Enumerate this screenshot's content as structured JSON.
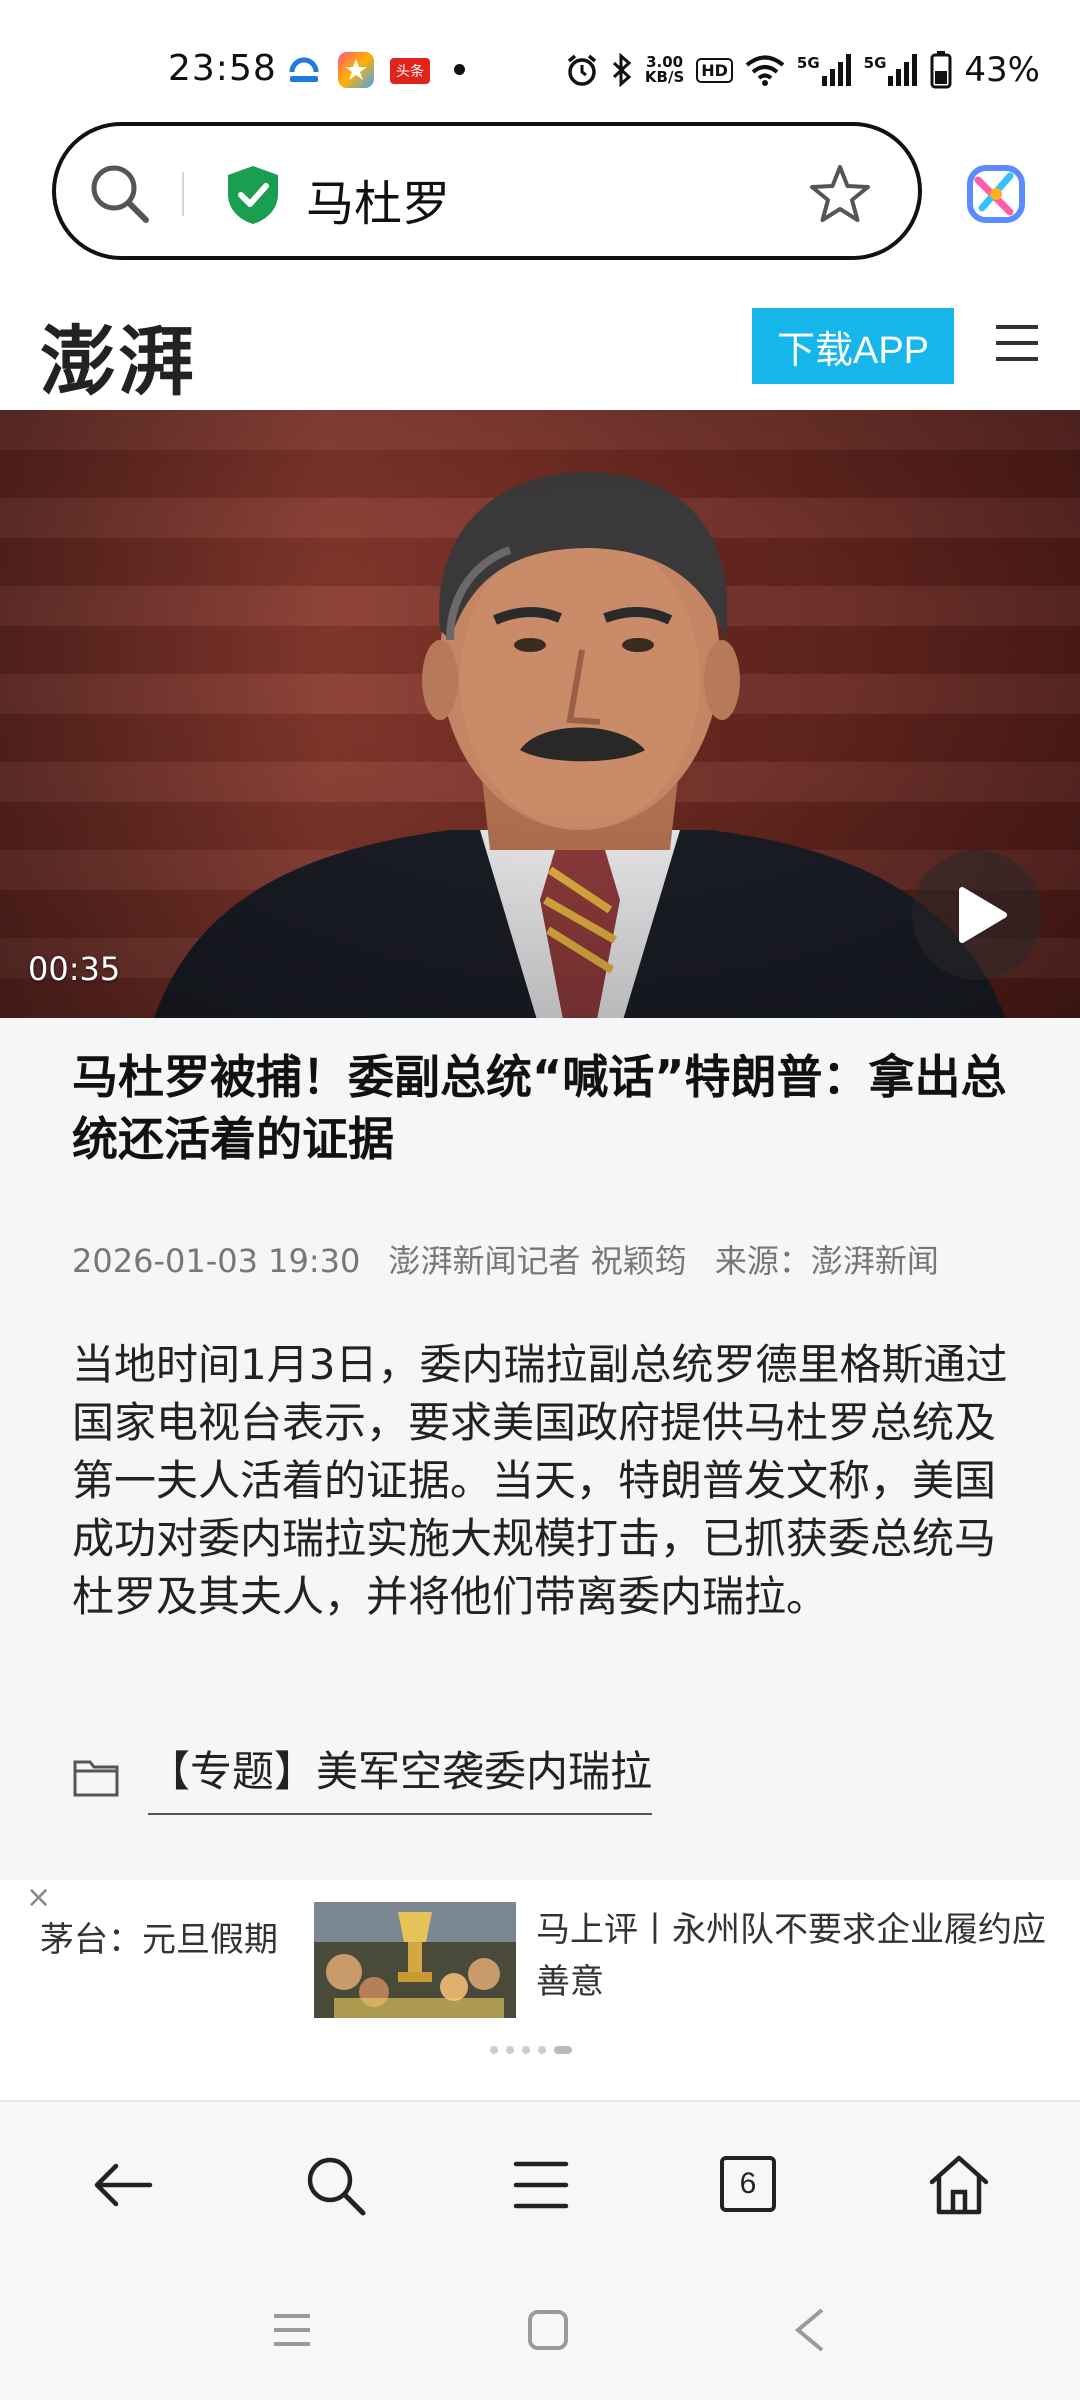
{
  "status_bar": {
    "time": "23:58",
    "notification_icons": [
      "security-app-icon",
      "star-app-icon",
      "toutiao-app-icon"
    ],
    "news_badge": "头条",
    "net_speed": "3.00",
    "net_unit": "KB/S",
    "hd_label": "HD",
    "signal_label_1": "5G",
    "signal_label_2": "5G",
    "battery_percent": "43%"
  },
  "address_bar": {
    "query": "马杜罗",
    "icons": [
      "search-icon",
      "secure-shield-icon",
      "bookmark-star-icon"
    ]
  },
  "site_header": {
    "logo_text": "澎湃",
    "download_label": "下载APP"
  },
  "video": {
    "duration": "00:35"
  },
  "article": {
    "title": "马杜罗被捕！委副总统“喊话”特朗普：拿出总统还活着的证据",
    "datetime": "2026-01-03 19:30",
    "reporter": "澎湃新闻记者 祝颖筠",
    "source": "来源：澎湃新闻",
    "body": "当地时间1月3日，委内瑞拉副总统罗德里格斯通过国家电视台表示，要求美国政府提供马杜罗总统及第一夫人活着的证据。当天，特朗普发文称，美国成功对委内瑞拉实施大规模打击，已抓获委总统马杜罗及其夫人，并将他们带离委内瑞拉。",
    "topic": "【专题】美军空袭委内瑞拉"
  },
  "recommendation": {
    "close": "×",
    "left_text": "茅台：元旦假期",
    "right_title": "马上评丨永州队不要求企业履约应善意"
  },
  "toolbar": {
    "tab_count": "6",
    "icons": [
      "back-arrow-icon",
      "search-icon",
      "menu-icon",
      "tabs-icon",
      "home-icon"
    ]
  },
  "colors": {
    "accent": "#16b6ea",
    "shield": "#1a9e4f",
    "article_bg": "#f5f6f7"
  }
}
